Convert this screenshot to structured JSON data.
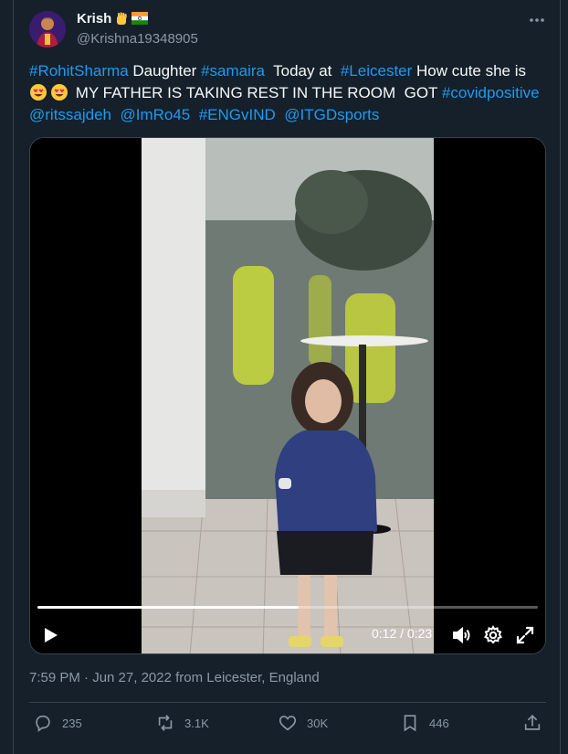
{
  "author": {
    "name": "Krish",
    "handle": "@Krishna19348905",
    "name_emojis": [
      "raised-fist-emoji",
      "india-flag-emoji"
    ]
  },
  "tweet": {
    "segments": [
      {
        "text": "#RohitSharma",
        "type": "tag"
      },
      {
        "text": " Daughter ",
        "type": "text"
      },
      {
        "text": "#samaira",
        "type": "tag"
      },
      {
        "text": "  Today at  ",
        "type": "text"
      },
      {
        "text": "#Leicester",
        "type": "tag"
      },
      {
        "text": " How cute she is",
        "type": "text"
      }
    ],
    "line2_text": " MY FATHER IS TAKING REST IN THE ROOM  GOT ",
    "line2_tag": "#covidpositive",
    "line3_tags": [
      "@ritssajdeh",
      "@ImRo45",
      "#ENGvIND",
      "@ITGDsports"
    ]
  },
  "video": {
    "current_time": "0:12",
    "duration": "0:23",
    "progress": 0.5217,
    "time_display": "0:12 / 0:23"
  },
  "meta": {
    "timestamp": "7:59 PM · Jun 27, 2022 from Leicester, England"
  },
  "actions": {
    "replies": "235",
    "reposts": "3.1K",
    "likes": "30K",
    "bookmarks": "446"
  },
  "colors": {
    "background": "#15202b",
    "link": "#1d9bf0",
    "secondary_text": "#8b98a5",
    "border": "#38444d"
  }
}
